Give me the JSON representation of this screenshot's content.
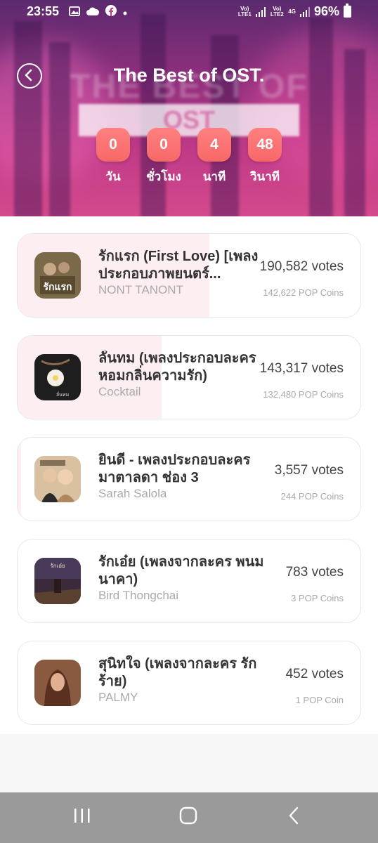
{
  "status_bar": {
    "time": "23:55",
    "battery": "96%",
    "lte1": "Vo) LTE1",
    "lte2": "Vo) LTE2",
    "net": "4G",
    "left_icons": [
      "image-icon",
      "cloud-icon",
      "facebook-icon",
      "dot-icon"
    ]
  },
  "header": {
    "title": "The Best of OST.",
    "background_text": "THE BEST OF",
    "background_box_text": "OST",
    "countdown": [
      {
        "value": "0",
        "label": "วัน"
      },
      {
        "value": "0",
        "label": "ชั่วโมง"
      },
      {
        "value": "4",
        "label": "นาที"
      },
      {
        "value": "48",
        "label": "วินาที"
      }
    ]
  },
  "songs": [
    {
      "title": "รักแรก (First Love) [เพลงประกอบภาพยนตร์...",
      "artist": "NONT TANONT",
      "votes": "190,582 votes",
      "coins": "142,622 POP Coins",
      "share": 0.56,
      "cover_color": "#6b5a3a"
    },
    {
      "title": "ลั่นทม (เพลงประกอบละคร หอมกลิ่นความรัก)",
      "artist": "Cocktail",
      "votes": "143,317 votes",
      "coins": "132,480 POP Coins",
      "share": 0.42,
      "cover_color": "#2a2a2a"
    },
    {
      "title": "ยินดี - เพลงประกอบละครมาตาลดา ช่อง 3",
      "artist": "Sarah Salola",
      "votes": "3,557 votes",
      "coins": "244 POP Coins",
      "share": 0.01,
      "cover_color": "#c9a27f"
    },
    {
      "title": "รักเอ๋ย (เพลงจากละคร พนมนาคา)",
      "artist": "Bird Thongchai",
      "votes": "783 votes",
      "coins": "3 POP Coins",
      "share": 0.0,
      "cover_color": "#4a3a4a"
    },
    {
      "title": "สุนิทใจ (เพลงจากละคร รักร้าย)",
      "artist": "PALMY",
      "votes": "452 votes",
      "coins": "1 POP Coin",
      "share": 0.0,
      "cover_color": "#8a5a40"
    }
  ],
  "nav": {
    "recents": "recents-icon",
    "home": "home-icon",
    "back": "back-icon"
  }
}
